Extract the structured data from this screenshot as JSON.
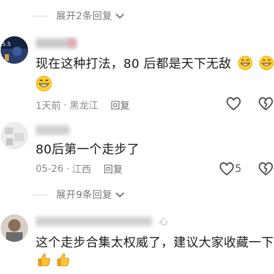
{
  "expand_top": {
    "label": "展开2条回复"
  },
  "comment1": {
    "avatar_badge": "5.5",
    "text": "现在这种打法，80 后都是天下无敌",
    "emoji": "grinning-face-emoji",
    "meta": {
      "time": "1天前",
      "location": "黑龙江",
      "reply": "回复"
    }
  },
  "comment2": {
    "text": "80后第一个走步了",
    "meta": {
      "time": "05-26",
      "location": "江西",
      "reply": "回复"
    },
    "like_count": "5"
  },
  "expand_mid": {
    "label": "展开9条回复"
  },
  "comment3": {
    "name_fragment": "心",
    "text": "这个走步合集太权威了，建议大家收藏一下",
    "emoji": "thumbs-up-emoji"
  },
  "colors": {
    "text": "#1b1b1b",
    "meta": "#8a8a8a",
    "icon": "#444444",
    "divider": "#d6d6d6"
  }
}
